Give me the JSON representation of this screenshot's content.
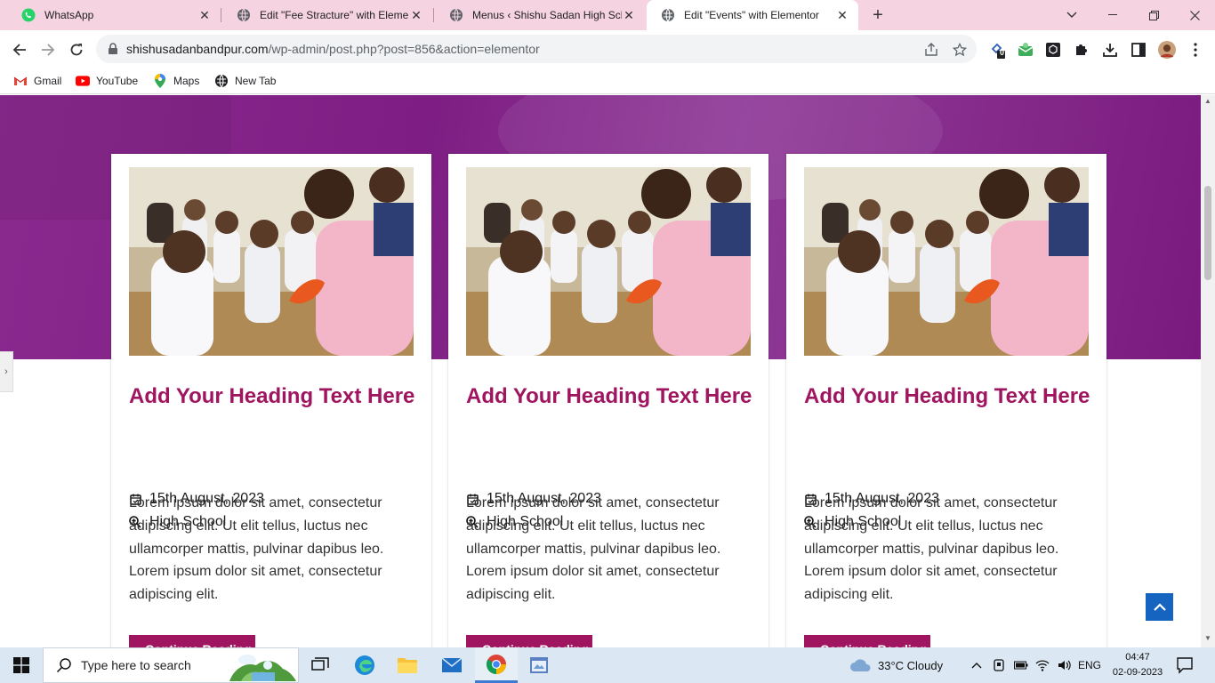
{
  "browser": {
    "tabs": [
      {
        "title": "WhatsApp",
        "icon": "whatsapp-icon"
      },
      {
        "title": "Edit \"Fee Stracture\" with Elementor",
        "icon": "globe-icon"
      },
      {
        "title": "Menus ‹ Shishu Sadan High School",
        "icon": "globe-icon"
      },
      {
        "title": "Edit \"Events\" with Elementor",
        "icon": "globe-icon"
      }
    ],
    "url_host": "shishusadanbandpur.com",
    "url_path": "/wp-admin/post.php?post=856&action=elementor",
    "extension_badge": "0",
    "bookmarks": [
      {
        "label": "Gmail",
        "icon": "gmail-icon"
      },
      {
        "label": "YouTube",
        "icon": "youtube-icon"
      },
      {
        "label": "Maps",
        "icon": "maps-icon"
      },
      {
        "label": "New Tab",
        "icon": "globe-icon"
      }
    ]
  },
  "cards": [
    {
      "heading": "Add Your Heading Text Here",
      "date": "15th August, 2023",
      "category": "High School",
      "text": "Lorem ipsum dolor sit amet, consectetur adipiscing elit. Ut elit tellus, luctus nec ullamcorper mattis, pulvinar dapibus leo. Lorem ipsum dolor sit amet, consectetur adipiscing elit.",
      "button": "Continue Reading"
    },
    {
      "heading": "Add Your Heading Text Here",
      "date": "15th August, 2023",
      "category": "High School",
      "text": "Lorem ipsum dolor sit amet, consectetur adipiscing elit. Ut elit tellus, luctus nec ullamcorper mattis, pulvinar dapibus leo. Lorem ipsum dolor sit amet, consectetur adipiscing elit.",
      "button": "Continue Reading"
    },
    {
      "heading": "Add Your Heading Text Here",
      "date": "15th August, 2023",
      "category": "High School",
      "text": "Lorem ipsum dolor sit amet, consectetur adipiscing elit. Ut elit tellus, luctus nec ullamcorper mattis, pulvinar dapibus leo. Lorem ipsum dolor sit amet, consectetur adipiscing elit.",
      "button": "Continue Reading"
    }
  ],
  "colors": {
    "accent": "#a0155f",
    "hero": "#7e1e84",
    "scroll_top": "#1565c0"
  },
  "taskbar": {
    "search_placeholder": "Type here to search",
    "weather": "33°C  Cloudy",
    "language": "ENG",
    "time": "04:47",
    "date": "02-09-2023"
  }
}
